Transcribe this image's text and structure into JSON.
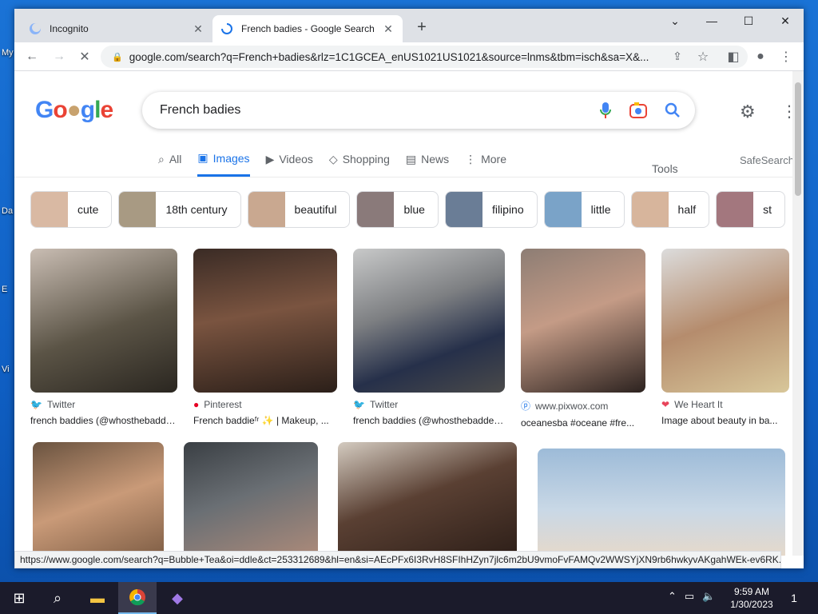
{
  "desktop": {
    "icons": [
      "My",
      "Da",
      "E",
      "Vi"
    ]
  },
  "browser": {
    "tabs": [
      {
        "title": "Incognito",
        "active": false
      },
      {
        "title": "French badies - Google Search",
        "active": true
      }
    ],
    "url": "google.com/search?q=French+badies&rlz=1C1GCEA_enUS1021US1021&source=lnms&tbm=isch&sa=X&...",
    "status_url": "https://www.google.com/search?q=Bubble+Tea&oi=ddle&ct=253312689&hl=en&si=AEcPFx6I3RvH8SFIhHZyn7jlc6m2bU9vmoFvFAMQv2WWSYjXN9rb6hwkyvAKgahWEk-ev6RK..."
  },
  "google": {
    "logo": "Google",
    "query": "French badies",
    "nav_tabs": [
      {
        "label": "All",
        "icon": "search-icon"
      },
      {
        "label": "Images",
        "icon": "image-icon",
        "selected": true
      },
      {
        "label": "Videos",
        "icon": "video-icon"
      },
      {
        "label": "Shopping",
        "icon": "tag-icon"
      },
      {
        "label": "News",
        "icon": "news-icon"
      },
      {
        "label": "More",
        "icon": "more-icon"
      }
    ],
    "tools": "Tools",
    "safesearch": "SafeSearch",
    "chips": [
      "cute",
      "18th century",
      "beautiful",
      "blue",
      "filipino",
      "little",
      "half",
      "st"
    ],
    "results": [
      {
        "source": "Twitter",
        "caption": "french baddies (@whosthebaddest...",
        "source_icon": "twitter-icon"
      },
      {
        "source": "Pinterest",
        "caption": "French baddieᶠʳ ✨ | Makeup, ...",
        "source_icon": "pinterest-icon"
      },
      {
        "source": "Twitter",
        "caption": "french baddies (@whosthebaddest...",
        "source_icon": "twitter-icon"
      },
      {
        "source": "www.pixwox.com",
        "caption": "oceanesba #oceane #fre...",
        "source_icon": "pixwox-icon"
      },
      {
        "source": "We Heart It",
        "caption": "Image about beauty in ba...",
        "source_icon": "heart-icon"
      }
    ]
  },
  "taskbar": {
    "time": "9:59 AM",
    "date": "1/30/2023",
    "notif_count": "1"
  }
}
